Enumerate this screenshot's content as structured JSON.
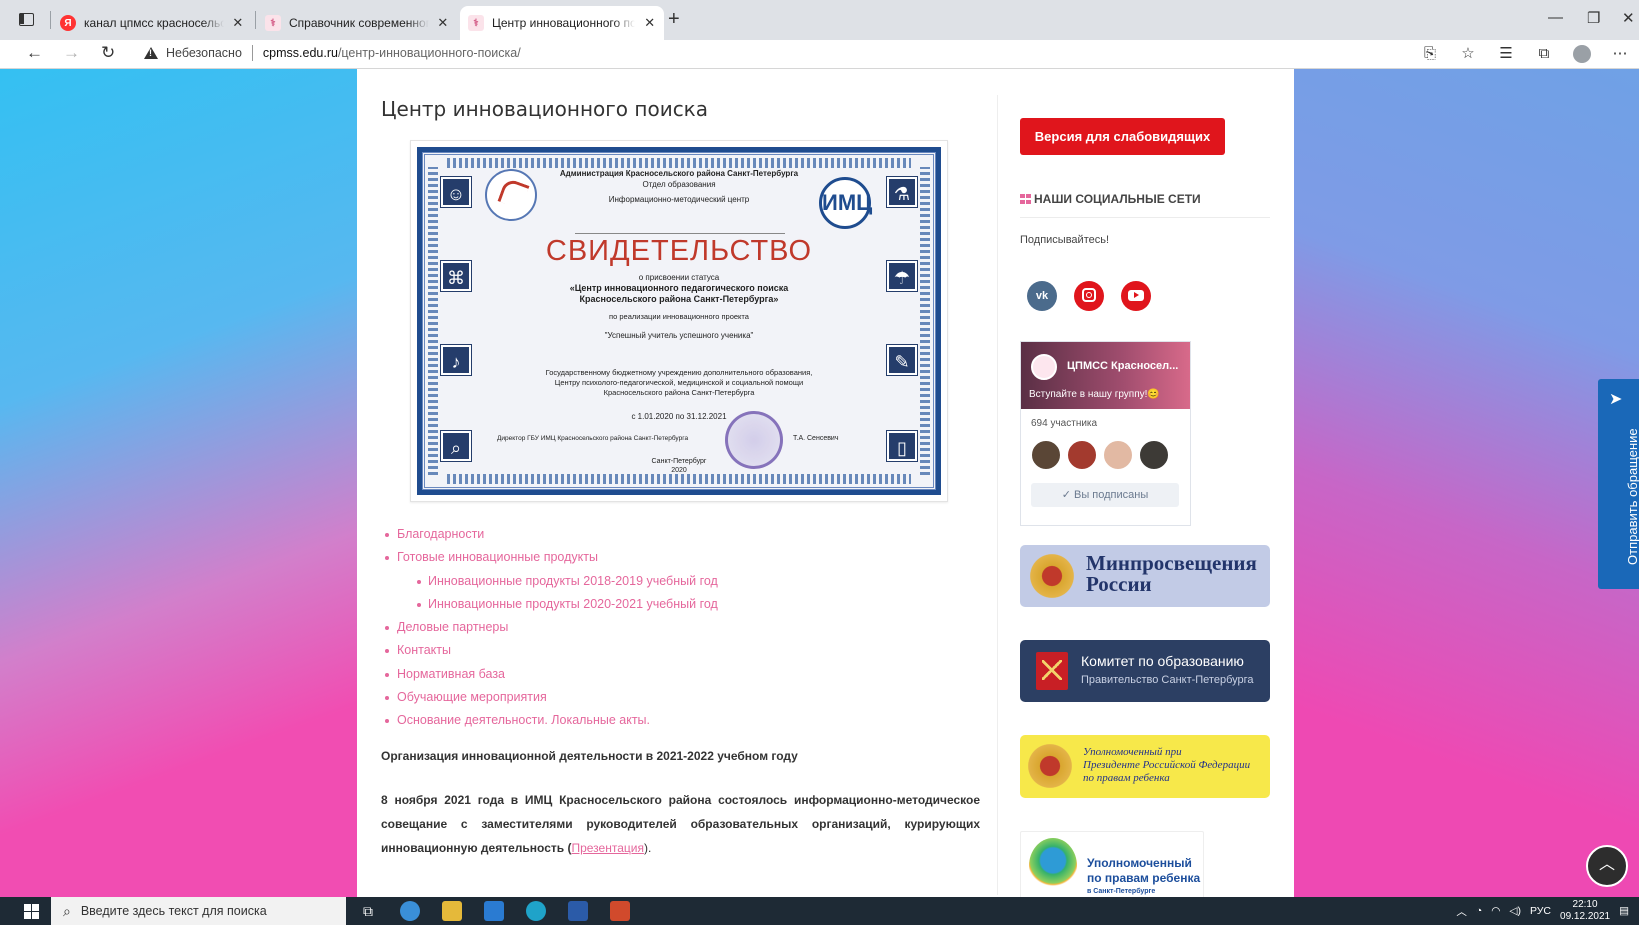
{
  "browser": {
    "tabs": [
      {
        "title": "канал цпмсс красносельского р",
        "favicon": "yandex-icon",
        "active": false
      },
      {
        "title": "Справочник современного кла",
        "favicon": "cpmss-icon",
        "active": false
      },
      {
        "title": "Центр инновационного поиска",
        "favicon": "cpmss-icon",
        "active": true
      }
    ],
    "url_warning": "Небезопасно",
    "url_host": "cpmss.edu.ru",
    "url_path": "/центр-инновационного-поиска/"
  },
  "page": {
    "title": "Центр инновационного поиска",
    "certificate": {
      "header1": "Администрация Красносельского района Санкт-Петербурга",
      "header2": "Отдел образования",
      "header3": "Информационно-методический центр",
      "heading": "СВИДЕТЕЛЬСТВО",
      "line1": "о присвоении статуса",
      "line2": "«Центр инновационного педагогического поиска",
      "line3": "Красносельского района Санкт-Петербурга»",
      "line4": "по реализации инновационного проекта",
      "line5": "\"Успешный учитель успешного ученика\"",
      "line6": "Государственному бюджетному учреждению дополнительного образования,",
      "line7": "Центру психолого-педагогической, медицинской и социальной помощи",
      "line8": "Красносельского района Санкт-Петербурга",
      "period": "с 1.01.2020 по 31.12.2021",
      "signer": "Директор ГБУ ИМЦ Красносельского района Санкт-Петербурга",
      "signer_name": "Т.А. Сенсевич",
      "city": "Санкт-Петербург",
      "year": "2020",
      "logo_right": "ИМЦ"
    },
    "menu": [
      {
        "label": "Благодарности",
        "level": 1
      },
      {
        "label": "Готовые инновационные продукты",
        "level": 1
      },
      {
        "label": "Инновационные продукты 2018-2019 учебный год",
        "level": 2
      },
      {
        "label": "Инновационные продукты 2020-2021 учебный год",
        "level": 2
      },
      {
        "label": "Деловые партнеры",
        "level": 1
      },
      {
        "label": "Контакты",
        "level": 1
      },
      {
        "label": "Нормативная база",
        "level": 1
      },
      {
        "label": "Обучающие мероприятия",
        "level": 1
      },
      {
        "label": "Основание деятельности. Локальные акты.",
        "level": 1
      }
    ],
    "section_heading": "Организация инновационной деятельности в 2021-2022 учебном году",
    "paragraph": "8 ноября 2021 года в ИМЦ Красносельского района состоялось информационно-методическое совещание с заместителями руководителей образовательных организаций, курирующих инновационную деятельность (",
    "paragraph_link": "Презентация",
    "paragraph_end": ")."
  },
  "sidebar": {
    "vision_button": "Версия для слабовидящих",
    "social_heading": "НАШИ СОЦИАЛЬНЫЕ СЕТИ",
    "subscribe_text": "Подписывайтесь!",
    "social_icons": [
      "vk-icon",
      "instagram-icon",
      "youtube-icon"
    ],
    "vk_widget": {
      "group_name": "ЦПМСС Красносел...",
      "invite": "Вступайте в нашу группу!😊",
      "members": "694 участника",
      "subscribed": "✓  Вы подписаны"
    },
    "banners": {
      "minpros": "Минпросвещения России",
      "minpros_line1": "Минпросвещения",
      "minpros_line2": "России",
      "komitet_title": "Комитет по образованию",
      "komitet_sub": "Правительство Санкт-Петербурга",
      "upolnom_l1": "Уполномоченный при",
      "upolnom_l2": "Президенте Российской Федерации",
      "upolnom_l3": "по правам ребенка",
      "spb_l1": "Уполномоченный",
      "spb_l2": "по правам ребенка",
      "spb_l3": "в Санкт-Петербурге"
    }
  },
  "feedback_tab": "Отправить обращение",
  "taskbar": {
    "search_placeholder": "Введите здесь текст для поиска",
    "language": "РУС",
    "time": "22:10",
    "date": "09.12.2021"
  },
  "colors": {
    "link": "#e5679c",
    "vision_button": "#e0151c",
    "feedback_tab": "#1a68b8"
  }
}
